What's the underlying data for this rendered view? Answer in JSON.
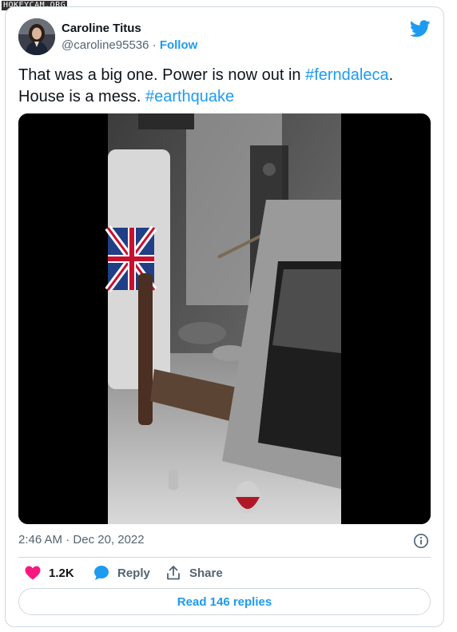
{
  "watermark": "HOKEYCAM.ORG",
  "author": {
    "name": "Caroline Titus",
    "handle": "@caroline95536",
    "separator": " · ",
    "follow_label": "Follow"
  },
  "tweet": {
    "text_part1": "That was a big one. Power is now out in ",
    "hashtag1": "#ferndaleca",
    "text_part2": ".",
    "text_line2": "House is a mess. ",
    "hashtag2": "#earthquake"
  },
  "meta": {
    "time": "2:46 AM",
    "separator": " · ",
    "date": "Dec 20, 2022"
  },
  "actions": {
    "likes_count": "1.2K",
    "reply_label": "Reply",
    "share_label": "Share"
  },
  "read_replies_label": "Read 146 replies",
  "colors": {
    "accent": "#1d9bf0",
    "like": "#f91880",
    "muted": "#536471",
    "border": "#cfd9de"
  },
  "icons": {
    "brand": "twitter-bird-icon",
    "info": "info-icon",
    "like": "heart-icon",
    "reply": "speech-bubble-icon",
    "share": "share-upload-icon"
  }
}
